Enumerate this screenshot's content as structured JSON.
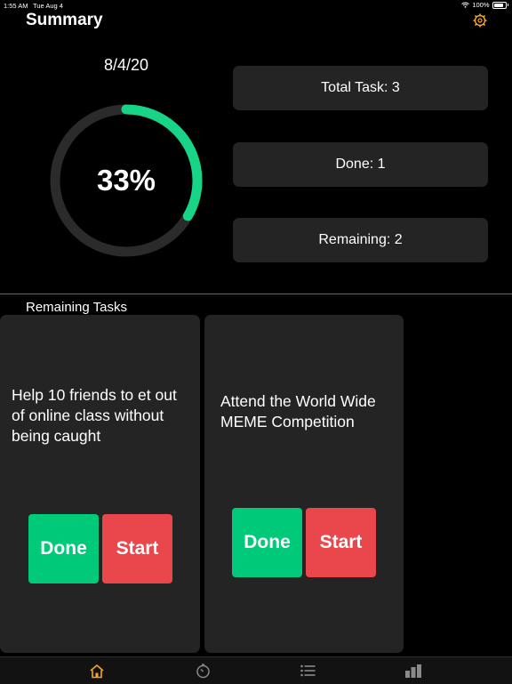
{
  "status_bar": {
    "time": "1:55 AM",
    "date": "Tue Aug 4",
    "battery": "100%"
  },
  "header": {
    "title": "Summary",
    "settings_icon": "gear-icon",
    "accent_color": "#f5a623"
  },
  "summary": {
    "date": "8/4/20",
    "progress_label": "33%",
    "progress_fraction": 0.333,
    "progress_color": "#18d486"
  },
  "stats": {
    "total": "Total Task: 3",
    "done": "Done: 1",
    "remaining": "Remaining: 2"
  },
  "remaining_tasks": {
    "title": "Remaining Tasks",
    "tasks": [
      {
        "text": "Help 10 friends to et out of online class without being caught",
        "done_label": "Done",
        "start_label": "Start"
      },
      {
        "text": "Attend the World Wide MEME Competition",
        "done_label": "Done",
        "start_label": "Start"
      }
    ]
  },
  "tab_bar": {
    "tabs": [
      {
        "icon": "home-icon",
        "active": true
      },
      {
        "icon": "timer-icon",
        "active": false
      },
      {
        "icon": "list-icon",
        "active": false
      },
      {
        "icon": "bar-chart-icon",
        "active": false
      }
    ]
  }
}
